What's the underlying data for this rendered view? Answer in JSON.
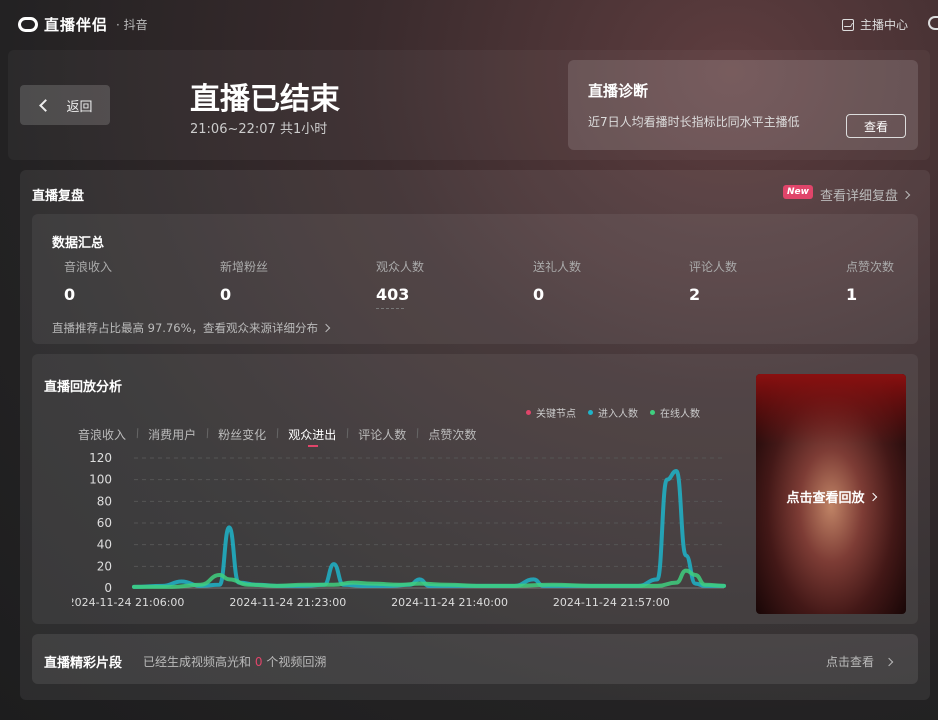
{
  "app": {
    "name": "直播伴侣",
    "platform": "· 抖音",
    "host_center": "主播中心"
  },
  "header": {
    "back_label": "返回",
    "title": "直播已结束",
    "time_range": "21:06~22:07 共1小时"
  },
  "diagnosis": {
    "title": "直播诊断",
    "text": "近7日人均看播时长指标比同水平主播低",
    "button": "查看"
  },
  "review": {
    "title": "直播复盘",
    "badge": "New",
    "detail_link": "查看详细复盘"
  },
  "summary": {
    "title": "数据汇总",
    "metrics": [
      {
        "label": "音浪收入",
        "value": "0"
      },
      {
        "label": "新增粉丝",
        "value": "0"
      },
      {
        "label": "观众人数",
        "value": "403"
      },
      {
        "label": "送礼人数",
        "value": "0"
      },
      {
        "label": "评论人数",
        "value": "2"
      },
      {
        "label": "点赞次数",
        "value": "1"
      }
    ],
    "note": "直播推荐占比最高 97.76%，查看观众来源详细分布"
  },
  "analysis": {
    "title": "直播回放分析",
    "tabs": [
      "音浪收入",
      "消费用户",
      "粉丝变化",
      "观众进出",
      "评论人数",
      "点赞次数"
    ],
    "active_tab": "观众进出",
    "legend": [
      {
        "label": "关键节点",
        "color": "#e0456a"
      },
      {
        "label": "进入人数",
        "color": "#1fb4c9"
      },
      {
        "label": "在线人数",
        "color": "#3fcf7f"
      }
    ]
  },
  "chart_data": {
    "type": "line",
    "x_ticks": [
      "2024-11-24 21:06:00",
      "2024-11-24 21:23:00",
      "2024-11-24 21:40:00",
      "2024-11-24 21:57:00"
    ],
    "y_ticks": [
      0,
      20,
      40,
      60,
      80,
      100,
      120
    ],
    "ylim": [
      0,
      120
    ],
    "xlim_minutes": [
      0,
      62
    ],
    "grid": true,
    "series": [
      {
        "name": "进入人数",
        "color": "#1fb4c9",
        "points": [
          [
            0,
            1
          ],
          [
            3,
            2
          ],
          [
            5,
            6
          ],
          [
            7,
            2
          ],
          [
            9,
            3
          ],
          [
            10,
            56
          ],
          [
            11,
            5
          ],
          [
            13,
            3
          ],
          [
            15,
            2
          ],
          [
            18,
            2
          ],
          [
            20,
            3
          ],
          [
            21,
            22
          ],
          [
            22,
            3
          ],
          [
            24,
            2
          ],
          [
            27,
            2
          ],
          [
            29,
            3
          ],
          [
            30,
            8
          ],
          [
            31,
            2
          ],
          [
            34,
            2
          ],
          [
            37,
            2
          ],
          [
            40,
            2
          ],
          [
            42,
            8
          ],
          [
            43,
            2
          ],
          [
            46,
            2
          ],
          [
            49,
            2
          ],
          [
            53,
            2
          ],
          [
            55,
            8
          ],
          [
            56,
            100
          ],
          [
            57,
            108
          ],
          [
            58,
            30
          ],
          [
            59,
            4
          ],
          [
            60,
            2
          ],
          [
            62,
            2
          ]
        ]
      },
      {
        "name": "在线人数",
        "color": "#3fcf7f",
        "points": [
          [
            0,
            1
          ],
          [
            4,
            1
          ],
          [
            7,
            3
          ],
          [
            9,
            12
          ],
          [
            10,
            8
          ],
          [
            12,
            3
          ],
          [
            15,
            2
          ],
          [
            18,
            3
          ],
          [
            21,
            3
          ],
          [
            23,
            5
          ],
          [
            25,
            4
          ],
          [
            28,
            3
          ],
          [
            30,
            4
          ],
          [
            33,
            3
          ],
          [
            36,
            2
          ],
          [
            40,
            2
          ],
          [
            44,
            3
          ],
          [
            48,
            2
          ],
          [
            52,
            2
          ],
          [
            55,
            2
          ],
          [
            57,
            5
          ],
          [
            58,
            16
          ],
          [
            59,
            12
          ],
          [
            60,
            3
          ],
          [
            62,
            2
          ]
        ]
      }
    ]
  },
  "replay": {
    "label": "点击查看回放"
  },
  "clips": {
    "title": "直播精彩片段",
    "text_before": "已经生成视频高光和",
    "count": "0",
    "text_after": "个视频回溯",
    "link": "点击查看"
  }
}
